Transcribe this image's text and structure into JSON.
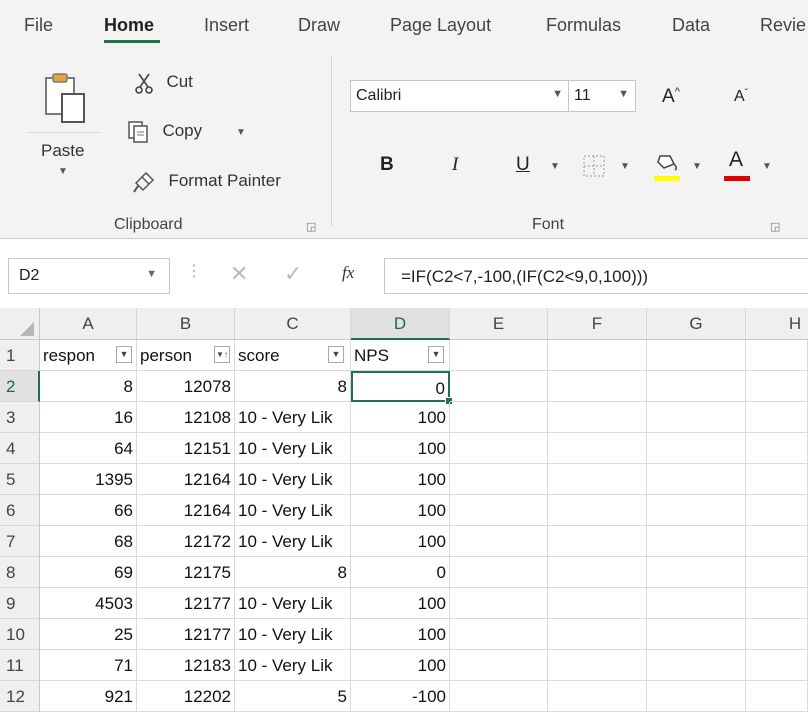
{
  "ribbon_tabs": [
    "File",
    "Home",
    "Insert",
    "Draw",
    "Page Layout",
    "Formulas",
    "Data",
    "Revie"
  ],
  "clipboard": {
    "paste_label": "Paste",
    "cut_label": "Cut",
    "copy_label": "Copy",
    "format_painter_label": "Format Painter",
    "group_label": "Clipboard"
  },
  "font_group": {
    "font_name": "Calibri",
    "font_size": "11",
    "increase_font": "A",
    "decrease_font": "A",
    "bold": "B",
    "italic": "I",
    "underline": "U",
    "font_color_letter": "A",
    "group_label": "Font",
    "highlight_color": "#ffff00",
    "font_color": "#e00000"
  },
  "formula_bar": {
    "name_box": "D2",
    "fx_label": "fx",
    "formula": "=IF(C2<7,-100,(IF(C2<9,0,100)))"
  },
  "grid": {
    "columns": [
      "A",
      "B",
      "C",
      "D",
      "E",
      "F",
      "G",
      "H"
    ],
    "selected_column": "D",
    "selected_row": "2",
    "headers": [
      "respon",
      "person",
      "score",
      "NPS"
    ],
    "rows": [
      {
        "row": "2",
        "a": "8",
        "b": "12078",
        "c": "8",
        "d": "0"
      },
      {
        "row": "3",
        "a": "16",
        "b": "12108",
        "c": "10 - Very Lik",
        "d": "100"
      },
      {
        "row": "4",
        "a": "64",
        "b": "12151",
        "c": "10 - Very Lik",
        "d": "100"
      },
      {
        "row": "5",
        "a": "1395",
        "b": "12164",
        "c": "10 - Very Lik",
        "d": "100"
      },
      {
        "row": "6",
        "a": "66",
        "b": "12164",
        "c": "10 - Very Lik",
        "d": "100"
      },
      {
        "row": "7",
        "a": "68",
        "b": "12172",
        "c": "10 - Very Lik",
        "d": "100"
      },
      {
        "row": "8",
        "a": "69",
        "b": "12175",
        "c": "8",
        "d": "0"
      },
      {
        "row": "9",
        "a": "4503",
        "b": "12177",
        "c": "10 - Very Lik",
        "d": "100"
      },
      {
        "row": "10",
        "a": "25",
        "b": "12177",
        "c": "10 - Very Lik",
        "d": "100"
      },
      {
        "row": "11",
        "a": "71",
        "b": "12183",
        "c": "10 - Very Lik",
        "d": "100"
      },
      {
        "row": "12",
        "a": "921",
        "b": "12202",
        "c": "5",
        "d": "-100"
      }
    ]
  },
  "accent_color": "#217346"
}
